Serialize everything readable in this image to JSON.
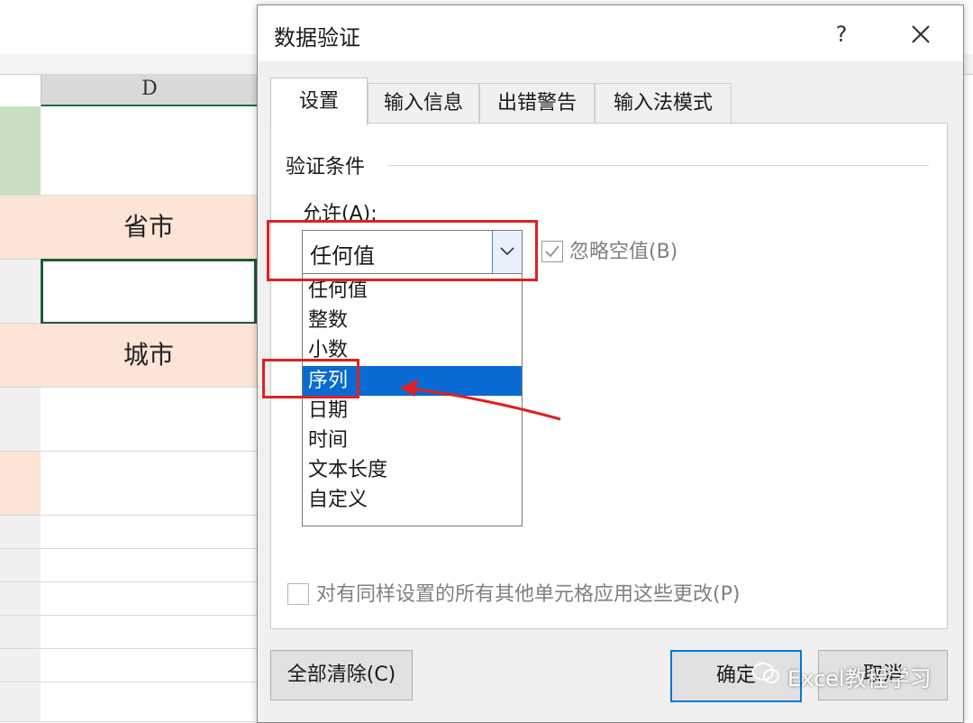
{
  "sheet": {
    "column_letter": "D",
    "cells": [
      {
        "text": ""
      },
      {
        "text": "省市"
      },
      {
        "text": ""
      },
      {
        "text": "城市"
      }
    ]
  },
  "dialog": {
    "title": "数据验证",
    "help_label": "?",
    "close_label": "×",
    "tabs": [
      {
        "label": "设置",
        "active": true
      },
      {
        "label": "输入信息",
        "active": false
      },
      {
        "label": "出错警告",
        "active": false
      },
      {
        "label": "输入法模式",
        "active": false
      }
    ],
    "settings": {
      "group_label": "验证条件",
      "allow_label": "允许(A):",
      "allow_value": "任何值",
      "ignore_blank_label": "忽略空值(B)",
      "ignore_blank_checked": true,
      "options": [
        "任何值",
        "整数",
        "小数",
        "序列",
        "日期",
        "时间",
        "文本长度",
        "自定义"
      ],
      "selected_option": "序列",
      "apply_all_label": "对有同样设置的所有其他单元格应用这些更改(P)",
      "apply_all_checked": false
    },
    "buttons": {
      "clear_all": "全部清除(C)",
      "ok": "确定",
      "cancel": "取消"
    }
  },
  "watermark": "Excel教程学习",
  "colors": {
    "selection_blue": "#0a6ad3",
    "annotation_red": "#e02020",
    "cell_peach": "#fce4d6",
    "active_cell_border": "#1e5d34"
  }
}
